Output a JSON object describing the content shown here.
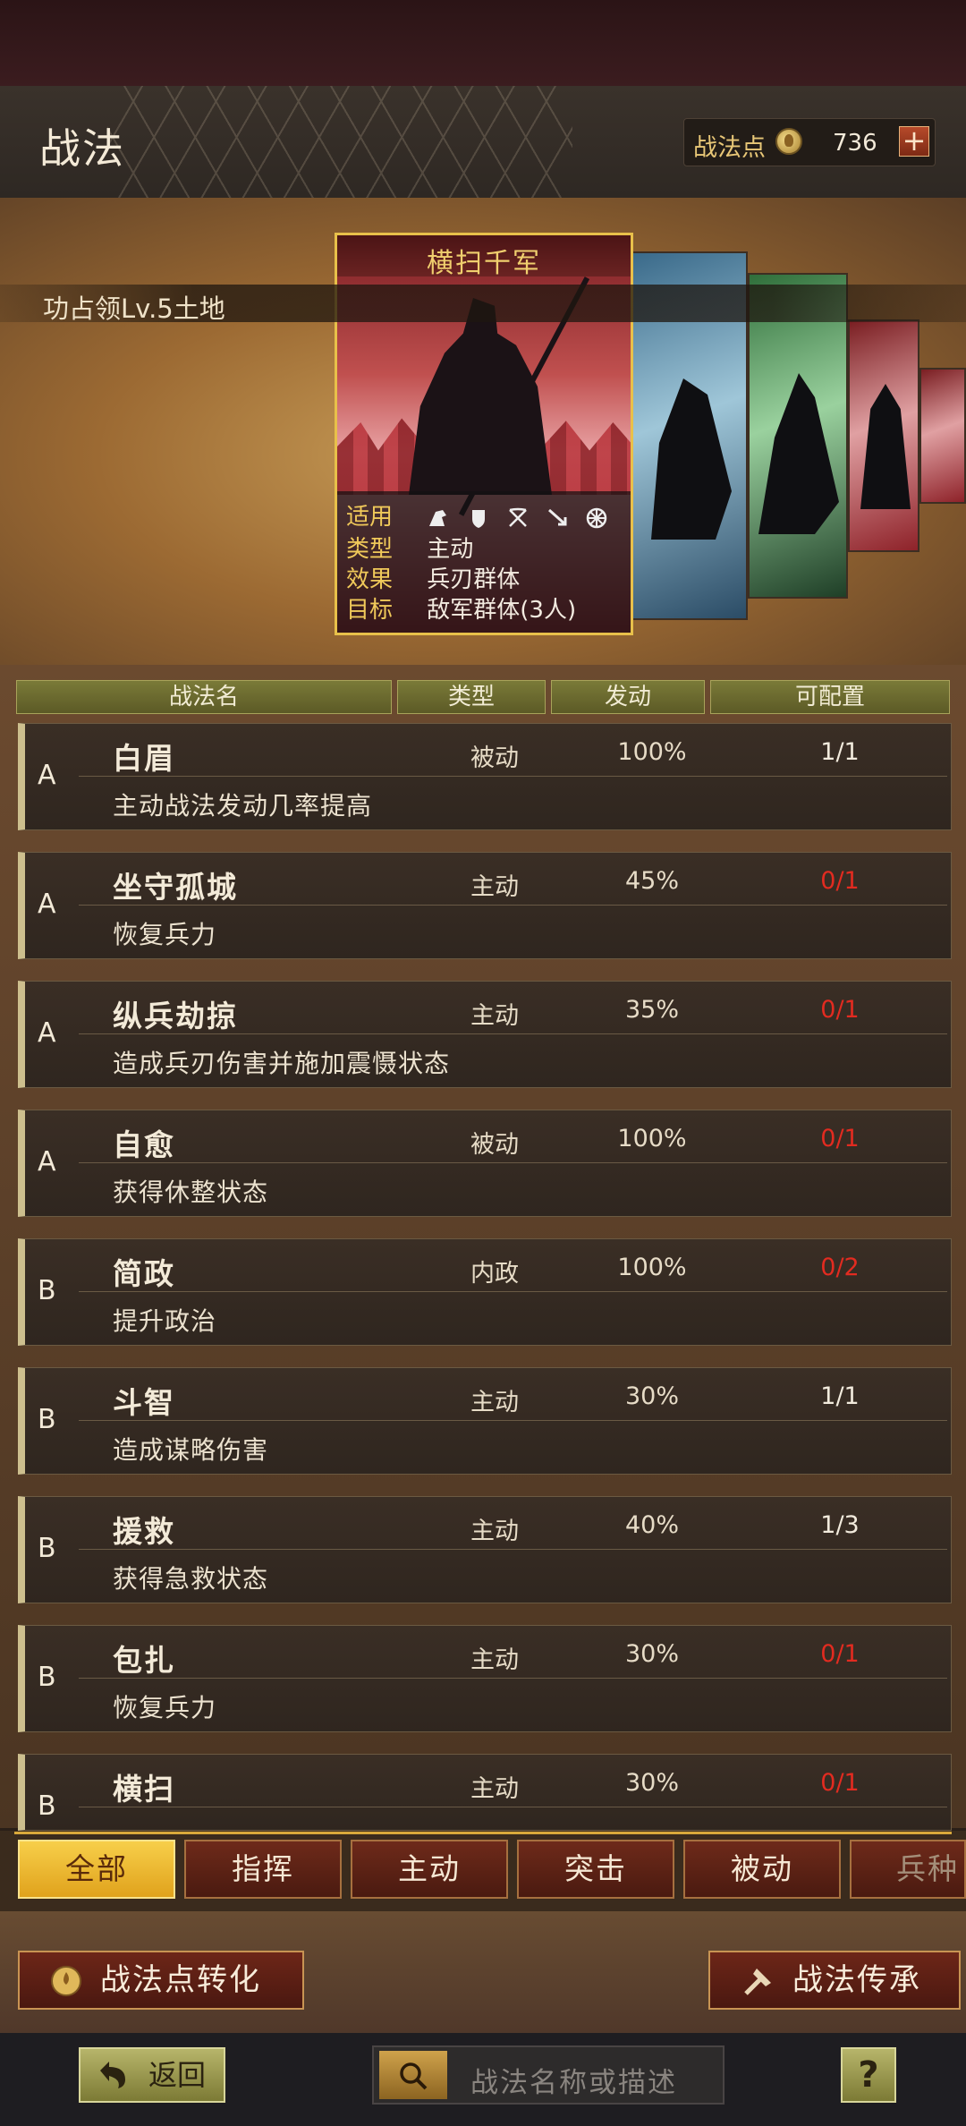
{
  "header": {
    "title": "战法",
    "points_label": "战法点",
    "points_value": "736",
    "plus_label": "+"
  },
  "banner": {
    "text": "功占领Lv.5土地"
  },
  "featured_card": {
    "title": "横扫千军",
    "rows": [
      {
        "key": "适用",
        "value": ""
      },
      {
        "key": "类型",
        "value": "主动"
      },
      {
        "key": "效果",
        "value": "兵刃群体"
      },
      {
        "key": "目标",
        "value": "敌军群体(3人)"
      }
    ],
    "troop_icons": [
      "cavalry-icon",
      "shield-icon",
      "bow-icon",
      "spear-icon",
      "siege-wheel-icon"
    ]
  },
  "table": {
    "headers": [
      "战法名",
      "类型",
      "发动",
      "可配置"
    ],
    "rows": [
      {
        "grade": "A",
        "name": "白眉",
        "type": "被动",
        "rate": "100%",
        "config": "1/1",
        "config_color": "#f2ebdd",
        "desc": "主动战法发动几率提高"
      },
      {
        "grade": "A",
        "name": "坐守孤城",
        "type": "主动",
        "rate": "45%",
        "config": "0/1",
        "config_color": "#e22b20",
        "desc": "恢复兵力"
      },
      {
        "grade": "A",
        "name": "纵兵劫掠",
        "type": "主动",
        "rate": "35%",
        "config": "0/1",
        "config_color": "#e22b20",
        "desc": "造成兵刃伤害并施加震慑状态"
      },
      {
        "grade": "A",
        "name": "自愈",
        "type": "被动",
        "rate": "100%",
        "config": "0/1",
        "config_color": "#e22b20",
        "desc": "获得休整状态"
      },
      {
        "grade": "B",
        "name": "简政",
        "type": "内政",
        "rate": "100%",
        "config": "0/2",
        "config_color": "#e22b20",
        "desc": "提升政治"
      },
      {
        "grade": "B",
        "name": "斗智",
        "type": "主动",
        "rate": "30%",
        "config": "1/1",
        "config_color": "#f2ebdd",
        "desc": "造成谋略伤害"
      },
      {
        "grade": "B",
        "name": "援救",
        "type": "主动",
        "rate": "40%",
        "config": "1/3",
        "config_color": "#f2ebdd",
        "desc": "获得急救状态"
      },
      {
        "grade": "B",
        "name": "包扎",
        "type": "主动",
        "rate": "30%",
        "config": "0/1",
        "config_color": "#e22b20",
        "desc": "恢复兵力"
      },
      {
        "grade": "B",
        "name": "横扫",
        "type": "主动",
        "rate": "30%",
        "config": "0/1",
        "config_color": "#e22b20",
        "desc": ""
      }
    ]
  },
  "filter_tabs": [
    {
      "label": "全部",
      "active": true
    },
    {
      "label": "指挥",
      "active": false
    },
    {
      "label": "主动",
      "active": false
    },
    {
      "label": "突击",
      "active": false
    },
    {
      "label": "被动",
      "active": false
    },
    {
      "label": "兵种",
      "active": false
    }
  ],
  "actions": {
    "convert_label": "战法点转化",
    "inherit_label": "战法传承"
  },
  "nav": {
    "back_label": "返回",
    "search_placeholder": "战法名称或描述",
    "help_label": "?"
  },
  "colors": {
    "accent_gold": "#e8c04a",
    "config_unavailable": "#e22b20",
    "active_tab": "#f7cf4a"
  }
}
